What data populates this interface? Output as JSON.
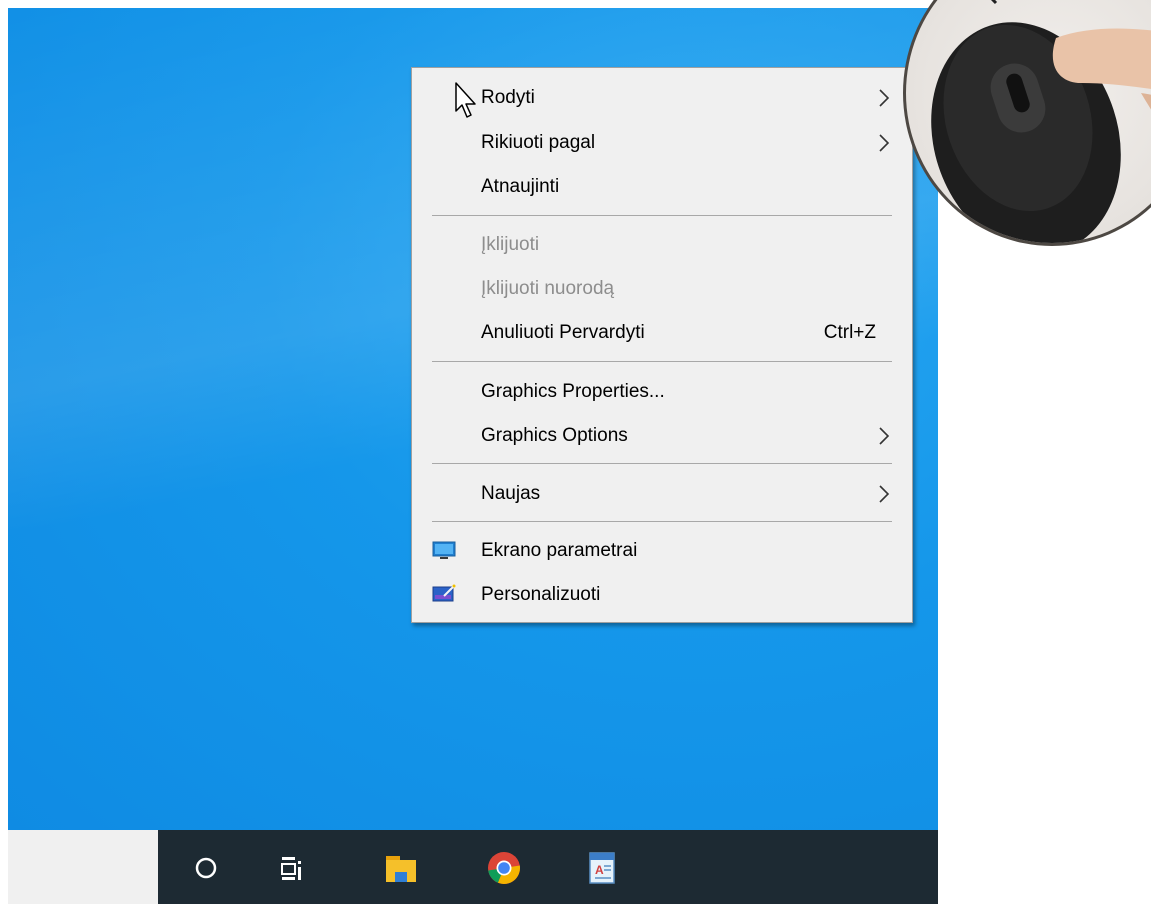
{
  "context_menu": {
    "items": [
      {
        "label": "Rodyti",
        "submenu": true,
        "disabled": false
      },
      {
        "label": "Rikiuoti pagal",
        "submenu": true,
        "disabled": false
      },
      {
        "label": "Atnaujinti",
        "submenu": false,
        "disabled": false
      },
      {
        "label": "Įklijuoti",
        "submenu": false,
        "disabled": true
      },
      {
        "label": "Įklijuoti nuorodą",
        "submenu": false,
        "disabled": true
      },
      {
        "label": "Anuliuoti Pervardyti",
        "shortcut": "Ctrl+Z",
        "submenu": false,
        "disabled": false
      },
      {
        "label": "Graphics Properties...",
        "submenu": false,
        "disabled": false
      },
      {
        "label": "Graphics Options",
        "submenu": true,
        "disabled": false
      },
      {
        "label": "Naujas",
        "submenu": true,
        "disabled": false
      },
      {
        "label": "Ekrano parametrai",
        "icon": "display-settings-icon",
        "submenu": false,
        "disabled": false
      },
      {
        "label": "Personalizuoti",
        "icon": "personalize-icon",
        "submenu": false,
        "disabled": false
      }
    ]
  },
  "taskbar": {
    "icons": [
      "cortana-search-icon",
      "task-view-icon",
      "file-explorer-icon",
      "chrome-icon",
      "wordpad-icon"
    ]
  },
  "colors": {
    "desktop": "#1597ea",
    "menu_background": "#f0f0f0",
    "taskbar": "#1d2a33",
    "disabled_text": "#8d8d8d"
  }
}
